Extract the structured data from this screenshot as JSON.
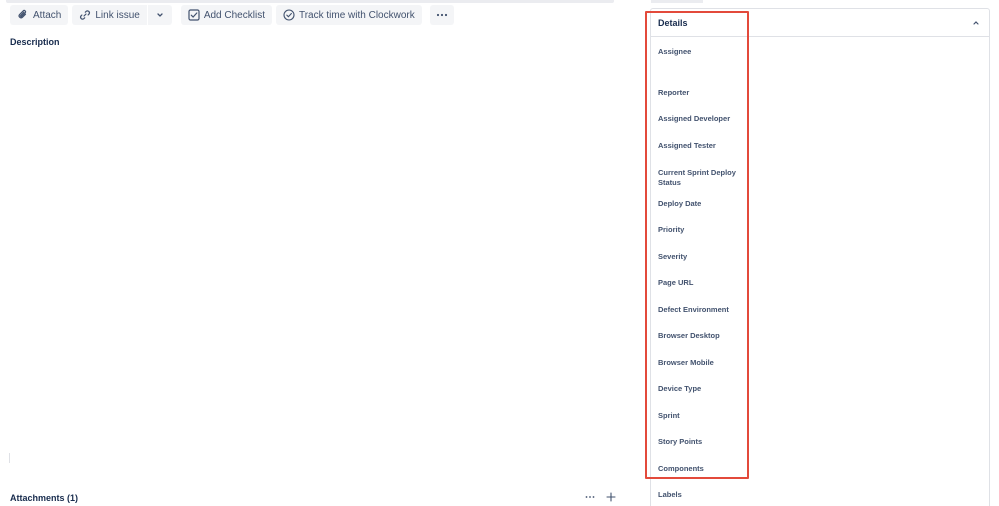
{
  "toolbar": {
    "attach_label": "Attach",
    "link_issue_label": "Link issue",
    "add_checklist_label": "Add Checklist",
    "track_time_label": "Track time with Clockwork"
  },
  "description": {
    "heading": "Description"
  },
  "attachments": {
    "heading": "Attachments (1)"
  },
  "details": {
    "title": "Details",
    "fields": [
      "Assignee",
      "Reporter",
      "Assigned Developer",
      "Assigned Tester",
      "Current Sprint Deploy Status",
      "Deploy Date",
      "Priority",
      "Severity",
      "Page URL",
      "Defect Environment",
      "Browser Desktop",
      "Browser Mobile",
      "Device Type",
      "Sprint",
      "Story Points",
      "Components",
      "Labels"
    ]
  },
  "colors": {
    "highlight": "#e34a3b",
    "button_bg": "#f4f5f7",
    "text_primary": "#172b4d",
    "text_secondary": "#42526e",
    "border": "#dfe1e6"
  },
  "icons": {
    "attach": "paperclip-icon",
    "link": "link-icon",
    "chevron": "chevron-down-icon",
    "checklist": "checkbox-icon",
    "clock": "clock-check-icon",
    "more": "more-icon",
    "plus": "plus-icon",
    "collapse": "chevron-up-icon"
  }
}
